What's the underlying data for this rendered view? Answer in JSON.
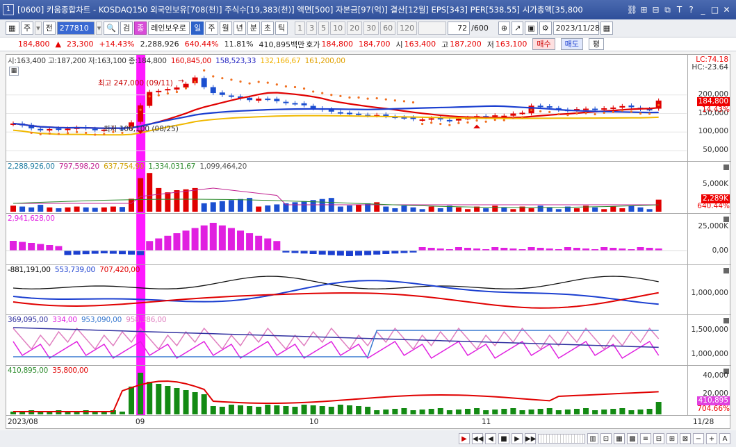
{
  "window": {
    "number": "1",
    "title": "[0600] 키움종합차트 - KOSDAQ150 외국인보유[708(천)] 주식수[19,383(천)] 액면[500] 자본금[97(억)] 결산[12월] EPS[343] PER[538.55] 시가총액[35,800"
  },
  "toolbar": {
    "period_week": "주",
    "prev": "전",
    "code": "277810",
    "search": "검",
    "mode_badge": "종",
    "name": "레인보우로",
    "tabs": [
      "일",
      "주",
      "월",
      "년",
      "분",
      "초",
      "틱"
    ],
    "active_tab": "일",
    "numbers": [
      "1",
      "3",
      "5",
      "10",
      "20",
      "30",
      "60",
      "120"
    ],
    "count": "72",
    "count_total": "/600",
    "date": "2023/11/28"
  },
  "quote": {
    "price": "184,800",
    "change": "23,300",
    "change_pct": "+14.43%",
    "volume": "2,288,926",
    "volume_pct": "640.44%",
    "turnover": "11.81%",
    "amount": "410,895백만",
    "ask_label": "호가",
    "ask1": "184,800",
    "ask2": "184,700",
    "open_label": "시",
    "open": "163,400",
    "high_label": "고",
    "high": "187,200",
    "low_label": "저",
    "low": "163,100",
    "buy": "매수",
    "sell": "매도",
    "eval": "평"
  },
  "panels": {
    "price": {
      "legend": [
        "시:163,400 고:187,200 저:163,100 종:184,800",
        "160,845,00",
        "158,523,33",
        "132,166,67",
        "161,200,00"
      ],
      "legend_colors": [
        "#333333",
        "#e00000",
        "#2020c0",
        "#f0b000",
        "#f0b000"
      ],
      "axis_top": [
        "LC:74.18",
        "HC:-23.64"
      ],
      "ticks": [
        "200,000",
        "150,000",
        "100,000",
        "50,000"
      ],
      "current": "184,800",
      "current_pct": "14.43%",
      "high_anno": "최고 247,000 (09/11)",
      "low_anno": "최저 106,100 (08/25)"
    },
    "volume": {
      "legend": [
        "2,288,926,00",
        "797,598,20",
        "637,754,90",
        "1,334,031,67",
        "1,099,464,20"
      ],
      "legend_colors": [
        "#1b7aa0",
        "#c02090",
        "#d0a000",
        "#2a8a2a",
        "#555555"
      ],
      "ticks": [
        "5,000K"
      ],
      "current": "2,289K",
      "current_pct": "640.44%"
    },
    "osc": {
      "legend": [
        "2,941,628,00"
      ],
      "legend_colors": [
        "#e020e0"
      ],
      "ticks": [
        "25,000K",
        "0,00"
      ]
    },
    "investor": {
      "legend": [
        "-881,191,00",
        "553,739,00",
        "707,420,00"
      ],
      "legend_colors": [
        "#000000",
        "#1b3fd0",
        "#e00000"
      ],
      "ticks": [
        "1,000,000"
      ]
    },
    "inst": {
      "legend": [
        "369,095,00",
        "334,00",
        "953,090,00",
        "958,386,00"
      ],
      "legend_colors": [
        "#3030a0",
        "#e020e0",
        "#3a7ad0",
        "#e080c0"
      ],
      "ticks": [
        "1,500,000",
        "1,000,000"
      ]
    },
    "amount": {
      "legend": [
        "410,895,00",
        "35,800,00"
      ],
      "legend_colors": [
        "#2a8a2a",
        "#e00000"
      ],
      "ticks": [
        "40,000",
        "20,000"
      ],
      "current": "410,895",
      "current_pct": "704.66%"
    }
  },
  "xaxis": [
    "2023/08",
    "09",
    "10",
    "11",
    "11/28"
  ],
  "colors": {
    "up": "#e00000",
    "down": "#1b4fd0",
    "highlight": "#ff00ff",
    "accent": "#2f4f9a"
  },
  "chart_data": {
    "type": "candlestick",
    "title": "",
    "y_range": [
      50000,
      250000
    ],
    "closes": [
      123000,
      118000,
      110000,
      106100,
      108000,
      107000,
      109000,
      112000,
      110000,
      105000,
      106500,
      112000,
      110000,
      126000,
      172000,
      208000,
      211000,
      216000,
      220000,
      230000,
      247000,
      221000,
      205000,
      200000,
      196000,
      191000,
      186000,
      190000,
      188000,
      183000,
      178000,
      176000,
      172000,
      164000,
      160000,
      155000,
      152000,
      148000,
      148000,
      145000,
      146000,
      143000,
      140000,
      138000,
      135000,
      134000,
      137000,
      134000,
      131000,
      136000,
      138000,
      143000,
      140000,
      145000,
      144000,
      150000,
      152000,
      171000,
      168000,
      166000,
      160000,
      158000,
      162000,
      163000,
      160000,
      164000,
      166000,
      170000,
      167000,
      162000,
      161500,
      184800
    ]
  }
}
